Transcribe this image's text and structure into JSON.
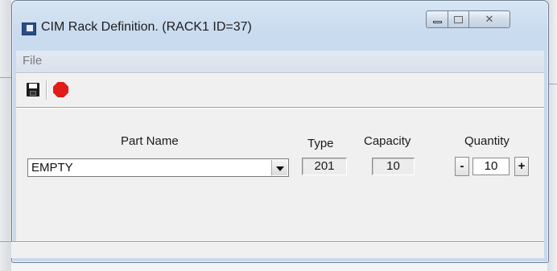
{
  "window": {
    "title": "CIM Rack Definition.  (RACK1  ID=37)",
    "close_glyph": "✕"
  },
  "menu": {
    "file_label": "File"
  },
  "toolbar": {
    "save_icon": "save-icon",
    "stop_icon": "stop-icon"
  },
  "columns": {
    "part_name_label": "Part Name",
    "type_label": "Type",
    "capacity_label": "Capacity",
    "quantity_label": "Quantity"
  },
  "row": {
    "part_name_value": "EMPTY",
    "type_value": "201",
    "capacity_value": "10",
    "quantity_value": "10",
    "decrement_label": "-",
    "increment_label": "+"
  },
  "colors": {
    "stop_red": "#e21a1a",
    "title_bar": "#c9dbee"
  }
}
